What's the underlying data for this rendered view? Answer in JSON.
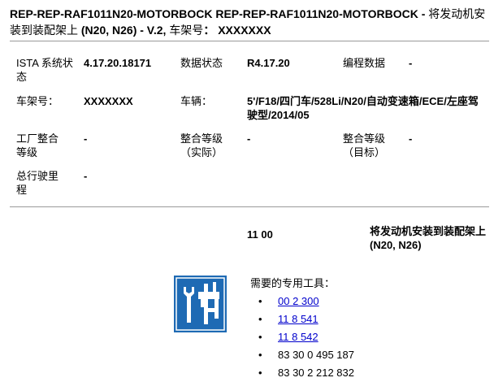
{
  "header": {
    "title_bold_1": "REP-REP-RAF1011N20-MOTORBOCK   REP-REP-RAF1011N20-MOTORBOCK - ",
    "title_cn_1": "将发动机安装到装配架上 ",
    "title_bold_2": "(N20, N26) - V.2, ",
    "title_cn_2": "车架号",
    "title_bold_3": "： XXXXXXX"
  },
  "info": {
    "ista_label": "ISTA 系统状态",
    "ista_value": "4.17.20.18171",
    "data_status_label": "数据状态",
    "data_status_value": "R4.17.20",
    "programming_label": "编程数据",
    "programming_value": "-",
    "vin_label": "车架号：",
    "vin_value": "XXXXXXX",
    "vehicle_label": "车辆：",
    "vehicle_value": "5'/F18/四门车/528Li/N20/自动变速箱/ECE/左座驾驶型/2014/05",
    "factory_level_label": "工厂整合等级",
    "factory_level_value": "-",
    "actual_level_label": "整合等级（实际）",
    "actual_level_value": "-",
    "target_level_label": "整合等级（目标）",
    "target_level_value": "-",
    "mileage_label": "总行驶里程",
    "mileage_value": "-"
  },
  "operation": {
    "code": "11 00",
    "description": "将发动机安装到装配架上 (N20, N26)"
  },
  "tools": {
    "heading": "需要的专用工具：",
    "icon": "special-tools-icon",
    "bullet": "•",
    "items": [
      {
        "label": "00 2 300",
        "link": true
      },
      {
        "label": "11 8 541",
        "link": true
      },
      {
        "label": "11 8 542",
        "link": true
      },
      {
        "label": "83 30 0 495 187",
        "link": false
      },
      {
        "label": "83 30 2 212 832",
        "link": false
      }
    ]
  },
  "colors": {
    "icon_bg": "#1e6ab4",
    "link": "#0000cc",
    "rule": "#9a9a9a"
  }
}
